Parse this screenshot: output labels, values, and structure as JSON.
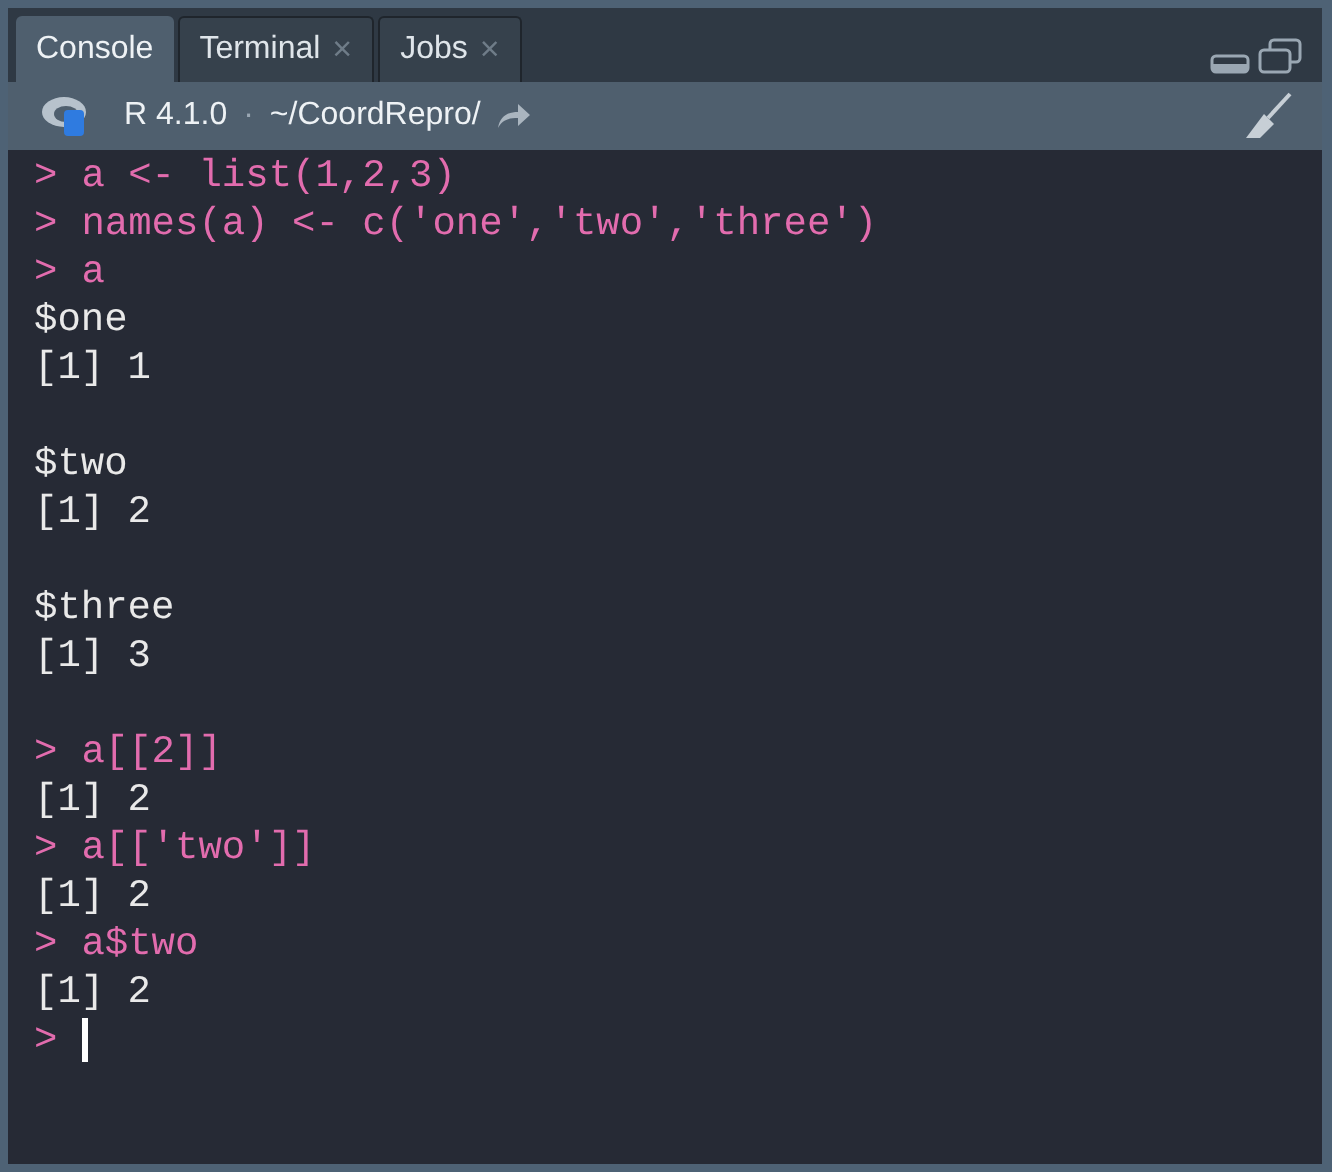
{
  "tabs": [
    {
      "label": "Console",
      "selected": true,
      "closable": false
    },
    {
      "label": "Terminal",
      "selected": false,
      "closable": true
    },
    {
      "label": "Jobs",
      "selected": false,
      "closable": true
    }
  ],
  "close_glyph": "×",
  "toolbar": {
    "version": "R 4.1.0",
    "separator": "·",
    "path": "~/CoordRepro/"
  },
  "console": [
    {
      "kind": "input",
      "prompt": ">",
      "text": "a <- list(1,2,3)"
    },
    {
      "kind": "input",
      "prompt": ">",
      "text": "names(a) <- c('one','two','three')"
    },
    {
      "kind": "input",
      "prompt": ">",
      "text": "a"
    },
    {
      "kind": "output",
      "text": "$one"
    },
    {
      "kind": "output",
      "text": "[1] 1"
    },
    {
      "kind": "blank"
    },
    {
      "kind": "output",
      "text": "$two"
    },
    {
      "kind": "output",
      "text": "[1] 2"
    },
    {
      "kind": "blank"
    },
    {
      "kind": "output",
      "text": "$three"
    },
    {
      "kind": "output",
      "text": "[1] 3"
    },
    {
      "kind": "blank"
    },
    {
      "kind": "input",
      "prompt": ">",
      "text": "a[[2]]"
    },
    {
      "kind": "output",
      "text": "[1] 2"
    },
    {
      "kind": "input",
      "prompt": ">",
      "text": "a[['two']]"
    },
    {
      "kind": "output",
      "text": "[1] 2"
    },
    {
      "kind": "input",
      "prompt": ">",
      "text": "a$two"
    },
    {
      "kind": "output",
      "text": "[1] 2"
    },
    {
      "kind": "cursor",
      "prompt": ">"
    }
  ]
}
